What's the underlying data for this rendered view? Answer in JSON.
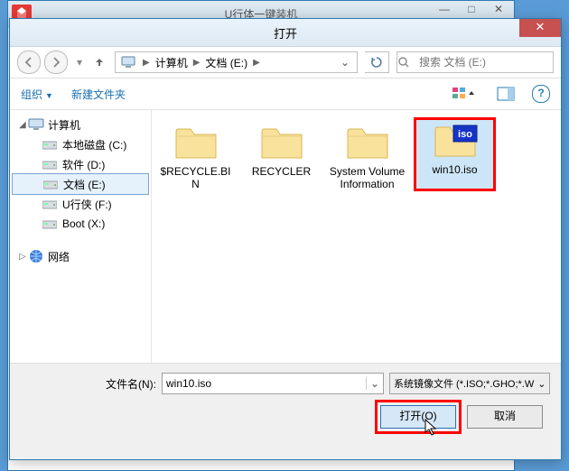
{
  "bg": {
    "title": "U行体一键装机"
  },
  "dialog": {
    "title": "打开"
  },
  "breadcrumb": {
    "root": "计算机",
    "path": "文档 (E:)"
  },
  "search": {
    "placeholder": "搜索 文档 (E:)"
  },
  "toolbar": {
    "organize": "组织",
    "newfolder": "新建文件夹"
  },
  "sidebar": {
    "computer": "计算机",
    "drives": [
      {
        "label": "本地磁盘 (C:)"
      },
      {
        "label": "软件 (D:)"
      },
      {
        "label": "文档 (E:)",
        "selected": true
      },
      {
        "label": "U行侠 (F:)"
      },
      {
        "label": "Boot (X:)"
      }
    ],
    "network": "网络"
  },
  "files": [
    {
      "label": "$RECYCLE.BIN",
      "type": "folder"
    },
    {
      "label": "RECYCLER",
      "type": "folder"
    },
    {
      "label": "System Volume Information",
      "type": "folder"
    },
    {
      "label": "win10.iso",
      "type": "iso",
      "highlight": true
    }
  ],
  "bottom": {
    "filename_label": "文件名(N):",
    "filename_value": "win10.iso",
    "filter": "系统镜像文件 (*.ISO;*.GHO;*.W",
    "open": "打开(O)",
    "cancel": "取消"
  }
}
